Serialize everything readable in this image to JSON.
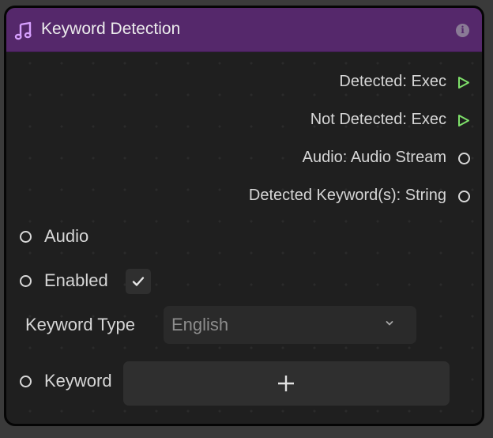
{
  "node": {
    "title": "Keyword Detection",
    "title_icon": "music-note-icon",
    "info_icon": "info-icon",
    "info_glyph": "i",
    "colors": {
      "header": "#55286b",
      "exec_pin": "#7ee06a",
      "body": "#1f1f1f"
    }
  },
  "outputs": [
    {
      "label": "Detected: Exec",
      "pin": "exec"
    },
    {
      "label": "Not Detected: Exec",
      "pin": "exec"
    },
    {
      "label": "Audio: Audio Stream",
      "pin": "data"
    },
    {
      "label": "Detected Keyword(s): String",
      "pin": "data"
    }
  ],
  "inputs": {
    "audio": {
      "label": "Audio"
    },
    "enabled": {
      "label": "Enabled",
      "checked": true
    },
    "keyword_type": {
      "label": "Keyword Type",
      "value": "English"
    },
    "keyword": {
      "label": "Keyword"
    }
  }
}
